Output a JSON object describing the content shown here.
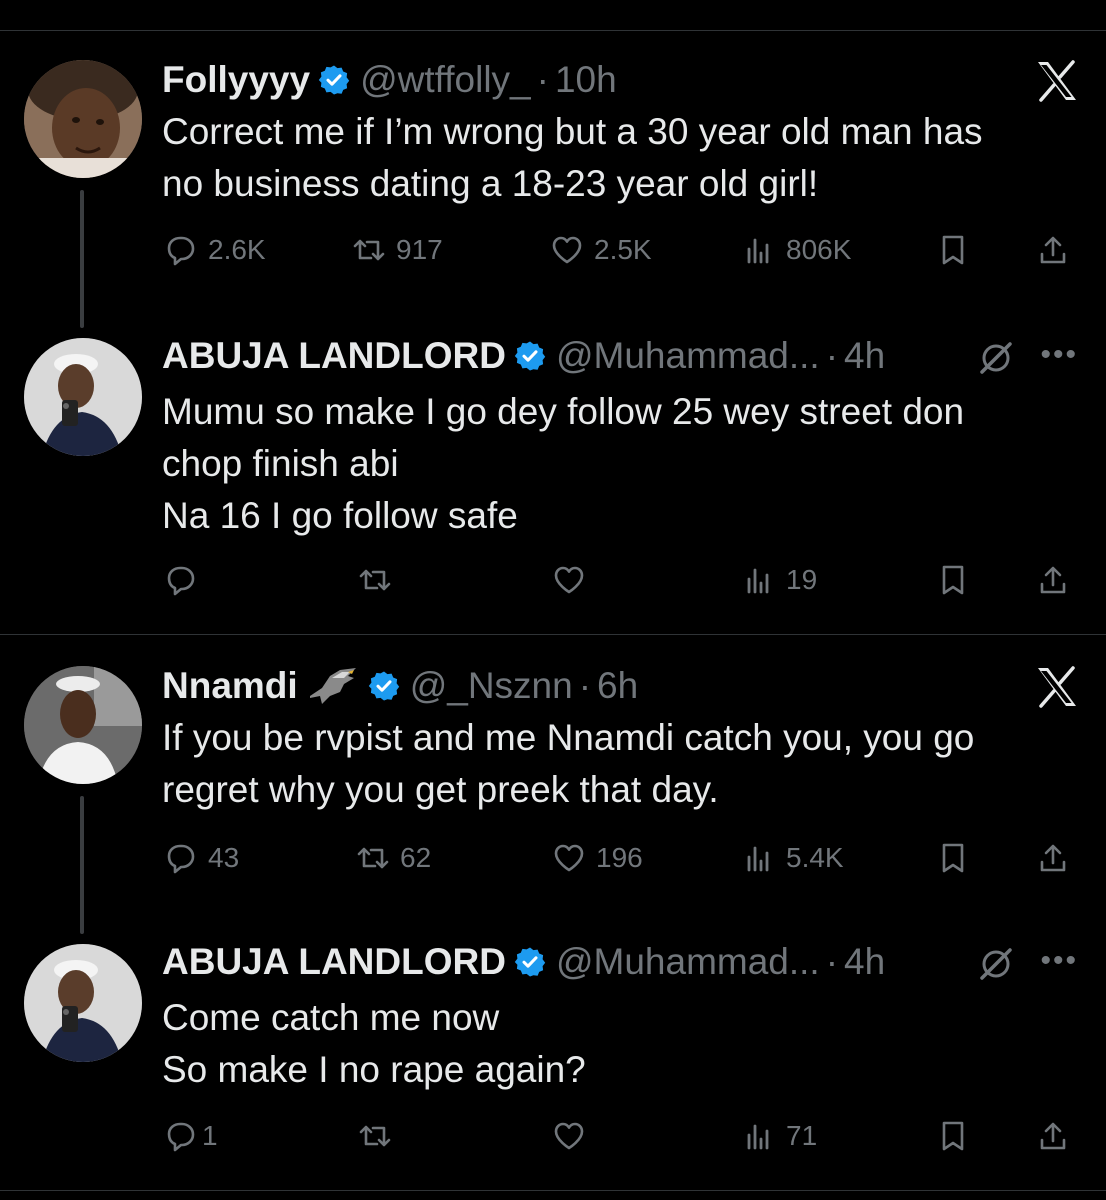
{
  "tweets": [
    {
      "name": "Follyyyy",
      "handle": "@wtffolly_",
      "time": "10h",
      "text": "Correct me if I’m wrong but a 30 year old man has\nno business  dating a 18-23 year old girl!",
      "replies": "2.6K",
      "retweets": "917",
      "likes": "2.5K",
      "views": "806K"
    },
    {
      "name": "ABUJA LANDLORD",
      "handle": "@Muhammad...",
      "time": "4h",
      "text": "Mumu so make I go dey follow 25 wey street don\nchop finish abi\nNa 16 I go follow safe",
      "replies": "",
      "retweets": "",
      "likes": "",
      "views": "19"
    },
    {
      "name": "Nnamdi",
      "handle": "@_Nsznn",
      "time": "6h",
      "text": "If you be rvpist and me Nnamdi catch you, you go\nregret why you get preek that day.",
      "replies": "43",
      "retweets": "62",
      "likes": "196",
      "views": "5.4K"
    },
    {
      "name": "ABUJA LANDLORD",
      "handle": "@Muhammad...",
      "time": "4h",
      "text": "Come catch me now\nSo make I no rape again?",
      "replies": "1",
      "retweets": "",
      "likes": "",
      "views": "71"
    }
  ],
  "more_label": "•••",
  "colors": {
    "background": "#000000",
    "text": "#e7e9ea",
    "muted": "#71767b",
    "verified": "#1d9bf0"
  },
  "icons": [
    "verified-badge-icon",
    "x-logo-icon",
    "grok-icon",
    "reply-icon",
    "retweet-icon",
    "like-icon",
    "views-icon",
    "bookmark-icon",
    "share-icon",
    "eagle-emoji-icon"
  ]
}
